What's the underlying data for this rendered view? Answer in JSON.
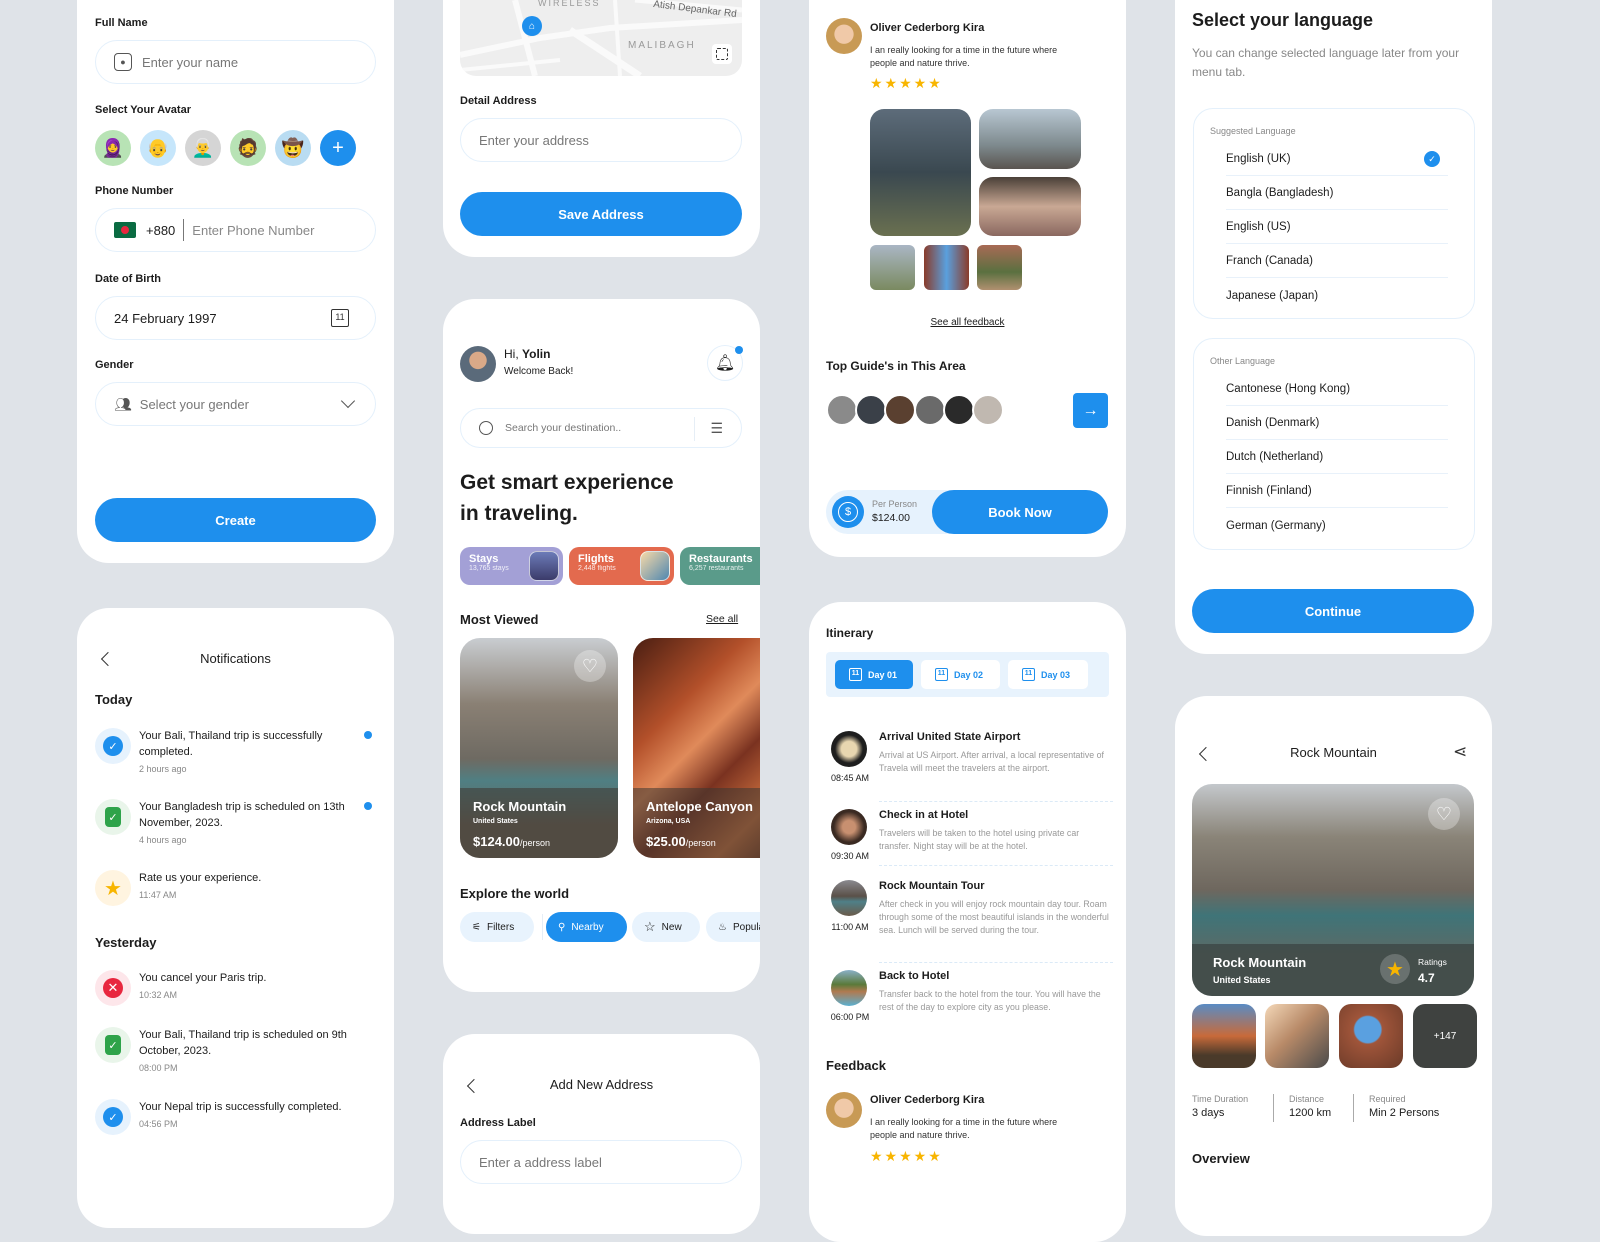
{
  "colors": {
    "accent": "#1e8fed",
    "background": "#dfe3e8",
    "star": "#f8b500",
    "stays": "#a3a0d6",
    "flights": "#e36a4e",
    "restaurants": "#5a9b8a",
    "error": "#e8273f",
    "success": "#2ea34a"
  },
  "profile": {
    "full_name_label": "Full Name",
    "full_name_placeholder": "Enter your name",
    "avatar_label": "Select Your Avatar",
    "avatars": [
      "avatar-1",
      "avatar-2",
      "avatar-3",
      "avatar-4",
      "avatar-5"
    ],
    "add_avatar_symbol": "+",
    "phone_label": "Phone Number",
    "phone_code": "+880",
    "phone_placeholder": "Enter Phone Number",
    "dob_label": "Date of Birth",
    "dob_value": "24 February 1997",
    "calendar_day": "11",
    "gender_label": "Gender",
    "gender_placeholder": "Select your gender",
    "create_button": "Create"
  },
  "notifications": {
    "title": "Notifications",
    "today_label": "Today",
    "yesterday_label": "Yesterday",
    "today": [
      {
        "text": "Your Bali, Thailand trip is successfully completed.",
        "time": "2 hours ago",
        "icon": "check-icon",
        "unread": true
      },
      {
        "text": "Your Bangladesh trip is scheduled on 13th November, 2023.",
        "time": "4 hours ago",
        "icon": "clipboard-icon",
        "unread": true
      },
      {
        "text": "Rate us your experience.",
        "time": "11:47 AM",
        "icon": "star-icon",
        "unread": false
      }
    ],
    "yesterday": [
      {
        "text": "You cancel your Paris trip.",
        "time": "10:32 AM",
        "icon": "cancel-icon"
      },
      {
        "text": "Your Bali, Thailand trip is scheduled on 9th October, 2023.",
        "time": "08:00 PM",
        "icon": "clipboard-icon"
      },
      {
        "text": "Your Nepal trip is successfully completed.",
        "time": "04:56 PM",
        "icon": "check-icon"
      }
    ]
  },
  "address": {
    "map_labels": {
      "area1": "WIRELESS",
      "road": "Atish Depankar Rd",
      "area2": "MALIBAGH"
    },
    "detail_label": "Detail Address",
    "detail_placeholder": "Enter your address",
    "save_button": "Save Address"
  },
  "home": {
    "greeting": "Hi,",
    "user_name": "Yolin",
    "welcome": "Welcome Back!",
    "search_placeholder": "Search your destination..",
    "headline_line1": "Get smart experience",
    "headline_line2": "in traveling.",
    "categories": [
      {
        "title": "Stays",
        "count": "13,765 stays"
      },
      {
        "title": "Flights",
        "count": "2,448 flights"
      },
      {
        "title": "Restaurants",
        "count": "6,257 restaurants"
      }
    ],
    "most_viewed_label": "Most Viewed",
    "see_all": "See all",
    "destinations": [
      {
        "name": "Rock Mountain",
        "location": "United States",
        "price": "$124.00",
        "unit": "/person"
      },
      {
        "name": "Antelope Canyon",
        "location": "Arizona, USA",
        "price": "$25.00",
        "unit": "/person"
      }
    ],
    "explore_label": "Explore the world",
    "filters": [
      {
        "label": "Filters",
        "icon": "sliders-icon",
        "active": false
      },
      {
        "label": "Nearby",
        "icon": "location-icon",
        "active": true
      },
      {
        "label": "New",
        "icon": "star-outline-icon",
        "active": false
      },
      {
        "label": "Popular",
        "icon": "fire-icon",
        "active": false
      }
    ]
  },
  "add_address": {
    "title": "Add New Address",
    "label_label": "Address Label",
    "label_placeholder": "Enter a address label"
  },
  "review": {
    "name": "Oliver Cederborg Kira",
    "text": "I an really looking for a time in the future where people and nature thrive.",
    "rating": 5,
    "stars": "★★★★★",
    "see_all_feedback": "See all feedback",
    "guides_label": "Top Guide's in This Area",
    "guide_count": 6,
    "per_person_label": "Per Person",
    "price": "$124.00",
    "book_button": "Book Now"
  },
  "itinerary": {
    "title": "Itinerary",
    "calendar_day": "11",
    "days": [
      {
        "label": "Day 01",
        "active": true
      },
      {
        "label": "Day 02",
        "active": false
      },
      {
        "label": "Day 03",
        "active": false
      }
    ],
    "items": [
      {
        "title": "Arrival United State Airport",
        "time": "08:45 AM",
        "desc": "Arrival at US Airport. After arrival, a local representative of Travela will meet the travelers at the airport."
      },
      {
        "title": "Check in at Hotel",
        "time": "09:30 AM",
        "desc": "Travelers will be taken to the hotel using private car transfer. Night stay will be at the hotel."
      },
      {
        "title": "Rock Mountain Tour",
        "time": "11:00 AM",
        "desc": "After check in you will enjoy rock mountain day tour. Roam through some of the most beautiful islands in the wonderful sea. Lunch will be served during the tour."
      },
      {
        "title": "Back to Hotel",
        "time": "06:00 PM",
        "desc": "Transfer back to the hotel from the tour. You will have the rest of the day to explore city as you please."
      }
    ],
    "feedback_label": "Feedback",
    "feedback": {
      "name": "Oliver Cederborg Kira",
      "text": "I an really looking for a time in the future where people and nature thrive.",
      "stars": "★★★★★",
      "rating": 5
    }
  },
  "language": {
    "title": "Select your language",
    "subtitle": "You can change selected language later from your menu tab.",
    "suggested_label": "Suggested Language",
    "suggested": [
      "English (UK)",
      "Bangla (Bangladesh)",
      "English (US)",
      "Franch (Canada)",
      "Japanese (Japan)"
    ],
    "selected": "English (UK)",
    "other_label": "Other Language",
    "other": [
      "Cantonese (Hong Kong)",
      "Danish (Denmark)",
      "Dutch (Netherland)",
      "Finnish (Finland)",
      "German (Germany)"
    ],
    "continue_button": "Continue"
  },
  "detail": {
    "title": "Rock Mountain",
    "name": "Rock Mountain",
    "location": "United States",
    "ratings_label": "Ratings",
    "rating": "4.7",
    "more_photos": "+147",
    "stats": [
      {
        "key": "Time Duration",
        "value": "3 days"
      },
      {
        "key": "Distance",
        "value": "1200 km"
      },
      {
        "key": "Required",
        "value": "Min 2 Persons"
      }
    ],
    "overview_label": "Overview"
  }
}
